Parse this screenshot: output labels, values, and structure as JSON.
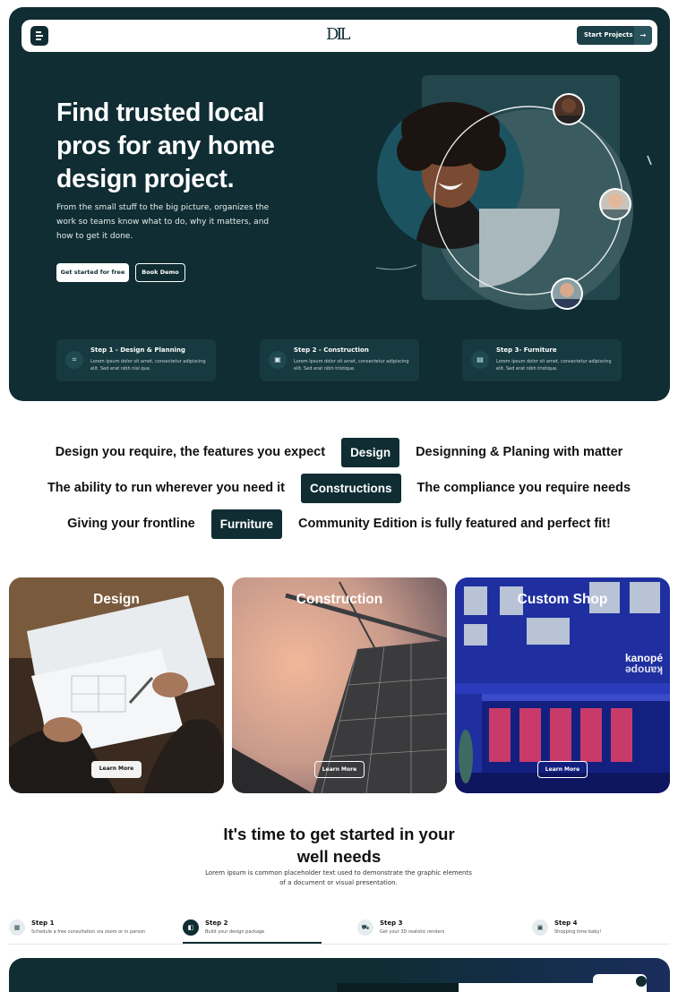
{
  "nav": {
    "logo_text": "DIL",
    "start_label": "Start Projects",
    "arrow": "→",
    "menu_icon": "menu-icon"
  },
  "hero": {
    "title": "Find trusted local pros for any home design project.",
    "description": "From the small stuff to the big picture, organizes the work so teams know what to do, why it matters, and how to get it done.",
    "primary_cta": "Get started for free",
    "secondary_cta": "Book Demo"
  },
  "steps": [
    {
      "title": "Step 1 - Design & Planning",
      "desc": "Lorem ipsum dolor sit amet, consectetur adipiscing elit. Sed erat nibh nisl que.",
      "icon": "grid-icon",
      "glyph": "⌗"
    },
    {
      "title": "Step 2 - Construction",
      "desc": "Lorem ipsum dolor sit amet, consectetur adipiscing elit. Sed erat nibh tristique.",
      "icon": "crane-icon",
      "glyph": "▣"
    },
    {
      "title": "Step 3- Furniture",
      "desc": "Lorem ipsum dolor sit amet, consectetur adipiscing elit. Sed erat nibh tristique.",
      "icon": "sofa-icon",
      "glyph": "▤"
    }
  ],
  "taglines": [
    {
      "left": "Design you require, the features you expect",
      "pill": "Design",
      "right": "Designning & Planing with matter"
    },
    {
      "left": "The ability to run wherever you need it",
      "pill": "Constructions",
      "right": "The compliance you require needs"
    },
    {
      "left": "Giving your frontline",
      "pill": "Furniture",
      "right": "Community Edition is fully featured and perfect fit!"
    }
  ],
  "cards": [
    {
      "title": "Design",
      "button": "Learn More"
    },
    {
      "title": "Construction",
      "button": "Learn More"
    },
    {
      "title": "Custom Shop",
      "button": "Learn More",
      "sign_top": "kanopé",
      "sign_bottom": "ǝdouɐʞ"
    }
  ],
  "cta": {
    "title_line1": "It's time to get started in your",
    "title_line2": "well needs",
    "desc": "Lorem ipsum is common placeholder text used to demonstrate the graphic elements of a document or visual presentation."
  },
  "process_tabs": [
    {
      "title": "Step 1",
      "desc": "Schedule a free consultation via zoom or in person",
      "icon": "calendar-icon",
      "glyph": "▦"
    },
    {
      "title": "Step 2",
      "desc": "Build your design package",
      "icon": "document-icon",
      "glyph": "◧"
    },
    {
      "title": "Step 3",
      "desc": "Get your 3D realistic renders",
      "icon": "car-icon",
      "glyph": "⛟"
    },
    {
      "title": "Step 4",
      "desc": "Shopping time baby!",
      "icon": "bag-icon",
      "glyph": "▣"
    }
  ],
  "colors": {
    "primary": "#0f2d33",
    "accent_pill": "#0f2d33",
    "card_shop_blue": "#1f2fa0"
  }
}
